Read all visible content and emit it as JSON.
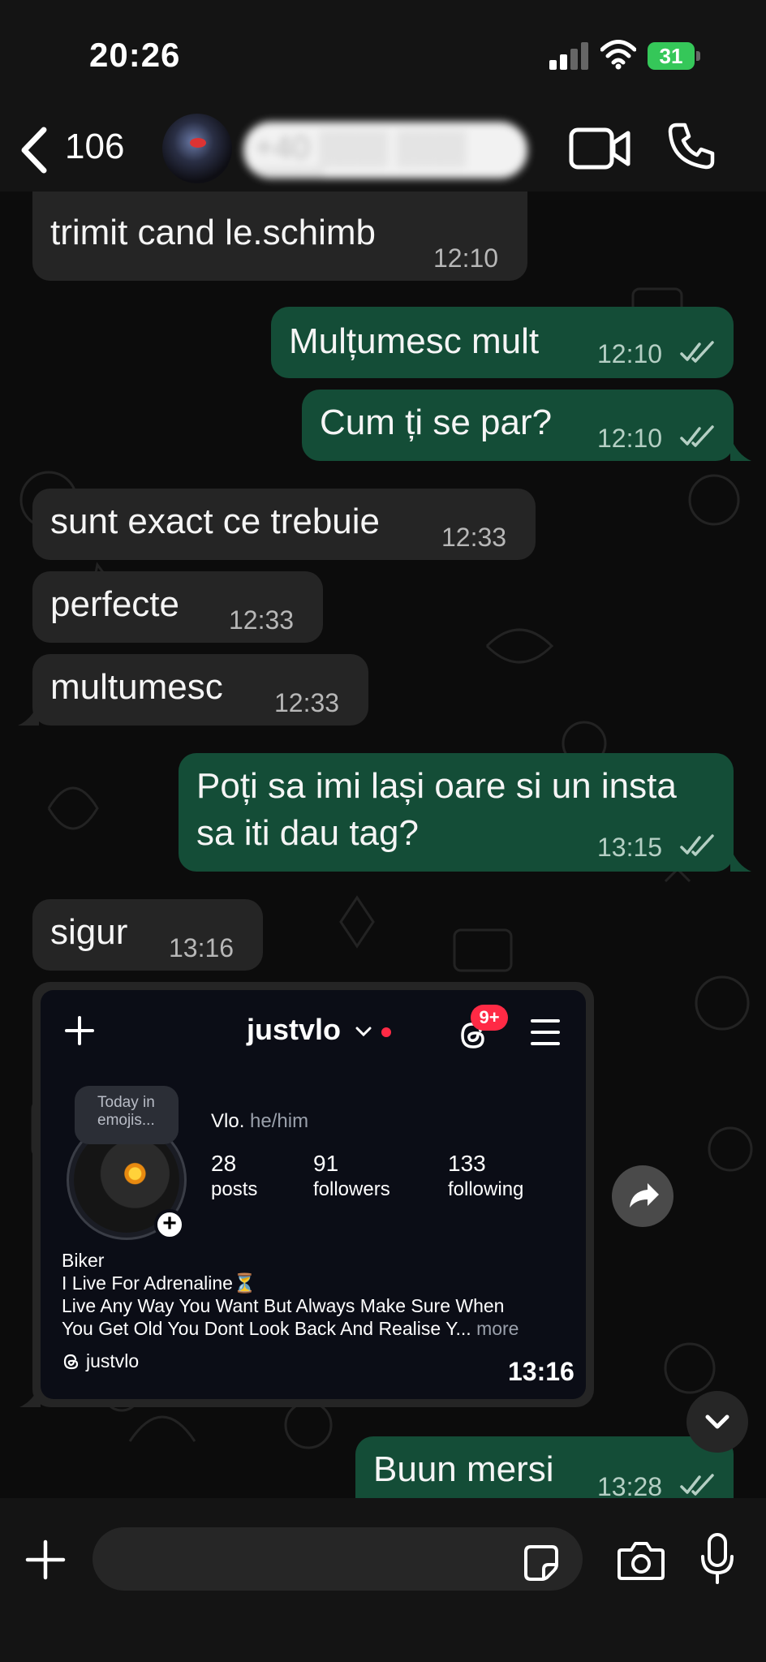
{
  "status_bar": {
    "time": "20:26",
    "battery": "31"
  },
  "header": {
    "back_count": "106",
    "contact_name": "+40 ▒▒▒ ▒▒▒ ▒▒▒"
  },
  "messages": [
    {
      "direction": "in",
      "text": "trimit cand le.schimb",
      "time": "12:10"
    },
    {
      "direction": "out",
      "text": "Mulțumesc mult",
      "time": "12:10"
    },
    {
      "direction": "out",
      "text": "Cum ți se par?",
      "time": "12:10"
    },
    {
      "direction": "in",
      "text": "sunt exact ce trebuie",
      "time": "12:33"
    },
    {
      "direction": "in",
      "text": "perfecte",
      "time": "12:33"
    },
    {
      "direction": "in",
      "text": "multumesc",
      "time": "12:33"
    },
    {
      "direction": "out",
      "text_line1": "Poți sa imi lași oare si un insta",
      "text_line2": "sa iti dau tag?",
      "time": "13:15"
    },
    {
      "direction": "in",
      "text": "sigur",
      "time": "13:16"
    },
    {
      "direction": "out",
      "text": "Buun mersi",
      "time": "13:28"
    }
  ],
  "instagram_card": {
    "username": "justvlo",
    "notification_badge": "9+",
    "note": "Today in emojis...",
    "display_name": "Vlo.",
    "pronouns": "he/him",
    "stats": [
      {
        "value": "28",
        "label": "posts"
      },
      {
        "value": "91",
        "label": "followers"
      },
      {
        "value": "133",
        "label": "following"
      }
    ],
    "bio": [
      "Biker",
      "I Live For Adrenaline⏳",
      "Live Any Way You Want But Always Make Sure When",
      "You Get Old You Dont Look Back And Realise Y..."
    ],
    "more_label": "more",
    "threads_handle": "justvlo",
    "time": "13:16"
  },
  "input": {
    "placeholder": ""
  },
  "colors": {
    "incoming_bubble": "#252525",
    "outgoing_bubble": "#144d37",
    "background": "#0c0c0c",
    "badge_red": "#ff2a45",
    "battery_green": "#35c759"
  },
  "icons": [
    "back-chevron-icon",
    "video-call-icon",
    "phone-call-icon",
    "read-receipt-icon",
    "forward-icon",
    "chevron-down-icon",
    "plus-icon",
    "sticker-icon",
    "camera-icon",
    "microphone-icon",
    "threads-icon",
    "menu-icon"
  ]
}
